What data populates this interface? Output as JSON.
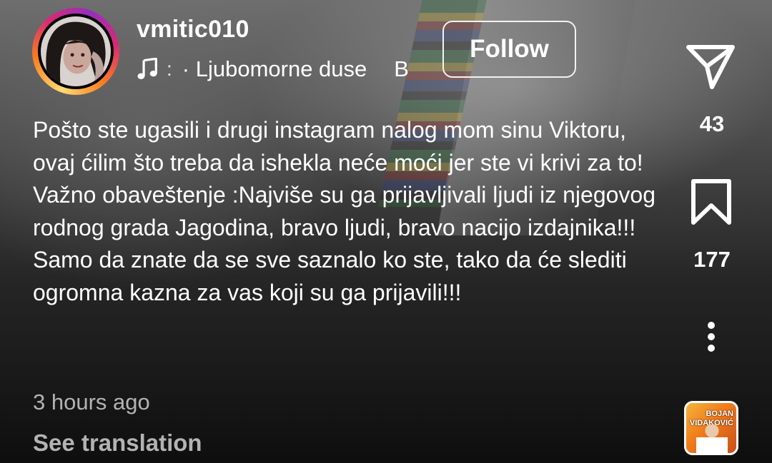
{
  "post": {
    "username": "vmitic010",
    "follow_label": "Follow",
    "music": {
      "dots": ":",
      "song": "· Ljubomorne duse",
      "artist": "B"
    },
    "caption": "Pošto ste ugasili i drugi instagram nalog mom sinu Viktoru, ovaj ćilim što treba da ishekla neće moći jer ste vi krivi za to! Važno obaveštenje :Najviše su ga prijavljivali ljudi iz njegovog rodnog grada Jagodina, bravo ljudi, bravo nacijo izdajnika!!! Samo da znate da se sve saznalo ko ste, tako da će slediti ogromna kazna za vas koji su ga prijavili!!!",
    "timestamp": "3 hours ago",
    "see_translation": "See translation"
  },
  "actions": {
    "send_count": "43",
    "save_count": "177"
  },
  "audio_thumbnail": {
    "line1": "BOJAN",
    "line2": "VIDAKOVIĆ"
  },
  "icons": {
    "music": "music-note-icon",
    "send": "send-icon",
    "save": "bookmark-icon",
    "more": "more-vertical-icon"
  },
  "colors": {
    "text": "#ffffff",
    "muted": "#b3b3b3",
    "story_ring": [
      "#feda75",
      "#fa7e1e",
      "#d62976",
      "#962fbf"
    ]
  }
}
